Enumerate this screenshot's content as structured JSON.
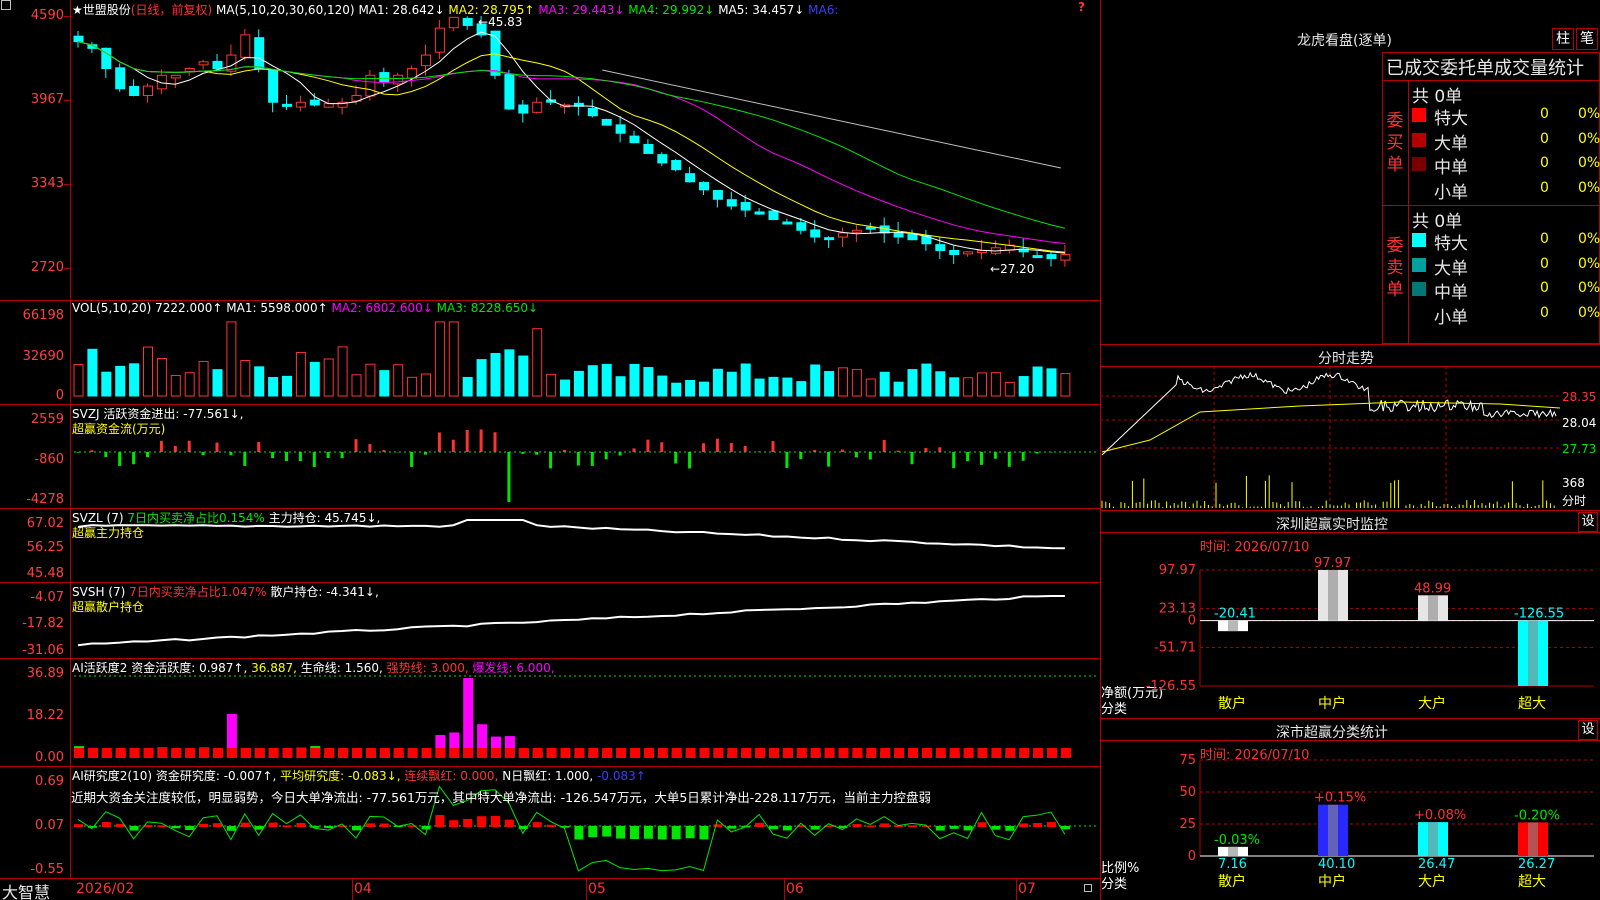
{
  "header": {
    "star": "★",
    "stock": "世盟股份",
    "mode": "(日线，前复权)",
    "ma_label": "MA(5,10,20,30,60,120)",
    "ma1": "MA1: 28.642↓",
    "ma2": "MA2: 28.795↑",
    "ma3": "MA3: 29.443↓",
    "ma4": "MA4: 29.992↓",
    "ma5": "MA5: 34.457↓",
    "ma6": "MA6:",
    "question": "?"
  },
  "price_axis": [
    "4590",
    "3967",
    "3343",
    "2720"
  ],
  "price_notes": {
    "high": "45.83",
    "low": "27.20"
  },
  "vol": {
    "label": "VOL(5,10,20)",
    "value": "7222.000↑",
    "ma1": "MA1: 5598.000↑",
    "ma2": "MA2: 6802.600↓",
    "ma3": "MA3: 8228.650↓",
    "axis": [
      "66198",
      "32690",
      "0"
    ]
  },
  "svzj": {
    "label": "SVZJ",
    "text": "活跃资金进出: -77.561↓,",
    "sub": "超赢资金流(万元)",
    "axis": [
      "2559",
      "-860",
      "-4278"
    ]
  },
  "svzl": {
    "label": "SVZL (7)",
    "text1": "7日内买卖净占比0.154%",
    "text2": "主力持仓: 45.745↓,",
    "sub": "超赢主力持仓",
    "axis": [
      "67.02",
      "56.25",
      "45.48"
    ]
  },
  "svsh": {
    "label": "SVSH (7)",
    "text1": "7日内买卖净占比1.047%",
    "text2": "散户持仓: -4.341↓,",
    "sub": "超赢散户持仓",
    "axis": [
      "-4.07",
      "-17.82",
      "-31.06"
    ]
  },
  "ai_active": {
    "label": "AI活跃度2",
    "t1": "资金活跃度: 0.987↑,",
    "t2": "36.887,",
    "t3": "生命线: 1.560,",
    "t4": "强势线: 3.000,",
    "t5": "爆发线: 6.000,",
    "axis": [
      "36.89",
      "18.22",
      "0.00"
    ]
  },
  "ai_research": {
    "label": "AI研究度2(10)",
    "t1": "资金研究度: -0.007↑,",
    "t2": "平均研究度: -0.083↓,",
    "t3": "连续飘红: 0.000,",
    "t4": "N日飘红: 1.000,",
    "t5": "-0.083↑",
    "comment": "近期大资金关注度较低，明显弱势，今日大单净流出: -77.561万元，其中特大单净流出: -126.547万元，大单5日累计净出-228.117万元，当前主力控盘弱",
    "axis": [
      "0.69",
      "0.07",
      "-0.55"
    ]
  },
  "time_axis": {
    "brand": "大智慧",
    "labels": [
      "2026/02",
      "04",
      "05",
      "06",
      "07"
    ]
  },
  "right": {
    "title": "龙虎看盘(逐单)",
    "btn_bar": "柱",
    "btn_pen": "笔",
    "stats_title": "已成交委托单成交量统计",
    "buy": {
      "side": "委买单",
      "total": "共 0单",
      "rows": [
        {
          "name": "特大",
          "count": "0",
          "pct": "0%",
          "color": "#ff0000"
        },
        {
          "name": "大单",
          "count": "0",
          "pct": "0%",
          "color": "#b40000"
        },
        {
          "name": "中单",
          "count": "0",
          "pct": "0%",
          "color": "#780000"
        },
        {
          "name": "小单",
          "count": "0",
          "pct": "0%",
          "color": "#000000"
        }
      ]
    },
    "sell": {
      "side": "委卖单",
      "total": "共 0单",
      "rows": [
        {
          "name": "特大",
          "count": "0",
          "pct": "0%",
          "color": "#00ffff"
        },
        {
          "name": "大单",
          "count": "0",
          "pct": "0%",
          "color": "#00a0a0"
        },
        {
          "name": "中单",
          "count": "0",
          "pct": "0%",
          "color": "#007878"
        },
        {
          "name": "小单",
          "count": "0",
          "pct": "0%",
          "color": "#000000"
        }
      ]
    },
    "intraday": {
      "title": "分时走势",
      "axis": [
        "28.35",
        "28.04",
        "27.73"
      ],
      "vol_top": "368",
      "vol_unit": "分时"
    },
    "monitor": {
      "title": "深圳超赢实时监控",
      "btn": "设",
      "time": "时间: 2026/07/10",
      "axis": [
        "97.97",
        "23.13",
        "0",
        "-51.71",
        "-126.55"
      ],
      "unit1": "净额(万元)",
      "unit2": "分类",
      "bars": [
        {
          "cat": "散户",
          "value": -20.41,
          "label": "-20.41",
          "color": "#ffffff"
        },
        {
          "cat": "中户",
          "value": 97.97,
          "label": "97.97",
          "color": "#e6e6e6"
        },
        {
          "cat": "大户",
          "value": 48.99,
          "label": "48.99",
          "color": "#e6e6e6"
        },
        {
          "cat": "超大",
          "value": -126.55,
          "label": "-126.55",
          "color": "#00ffff"
        }
      ]
    },
    "classify": {
      "title": "深市超赢分类统计",
      "btn": "设",
      "time": "时间: 2026/07/10",
      "axis": [
        "75",
        "50",
        "25",
        "0"
      ],
      "unit1": "比例%",
      "unit2": "分类",
      "bars": [
        {
          "cat": "散户",
          "value": 7.16,
          "label": "7.16",
          "delta": "-0.03%",
          "color": "#ffffff"
        },
        {
          "cat": "中户",
          "value": 40.1,
          "label": "40.10",
          "delta": "+0.15%",
          "color": "#2828ff"
        },
        {
          "cat": "大户",
          "value": 26.47,
          "label": "26.47",
          "delta": "+0.08%",
          "color": "#00ffff"
        },
        {
          "cat": "超大",
          "value": 26.27,
          "label": "26.27",
          "delta": "-0.20%",
          "color": "#ff0000"
        }
      ]
    }
  }
}
